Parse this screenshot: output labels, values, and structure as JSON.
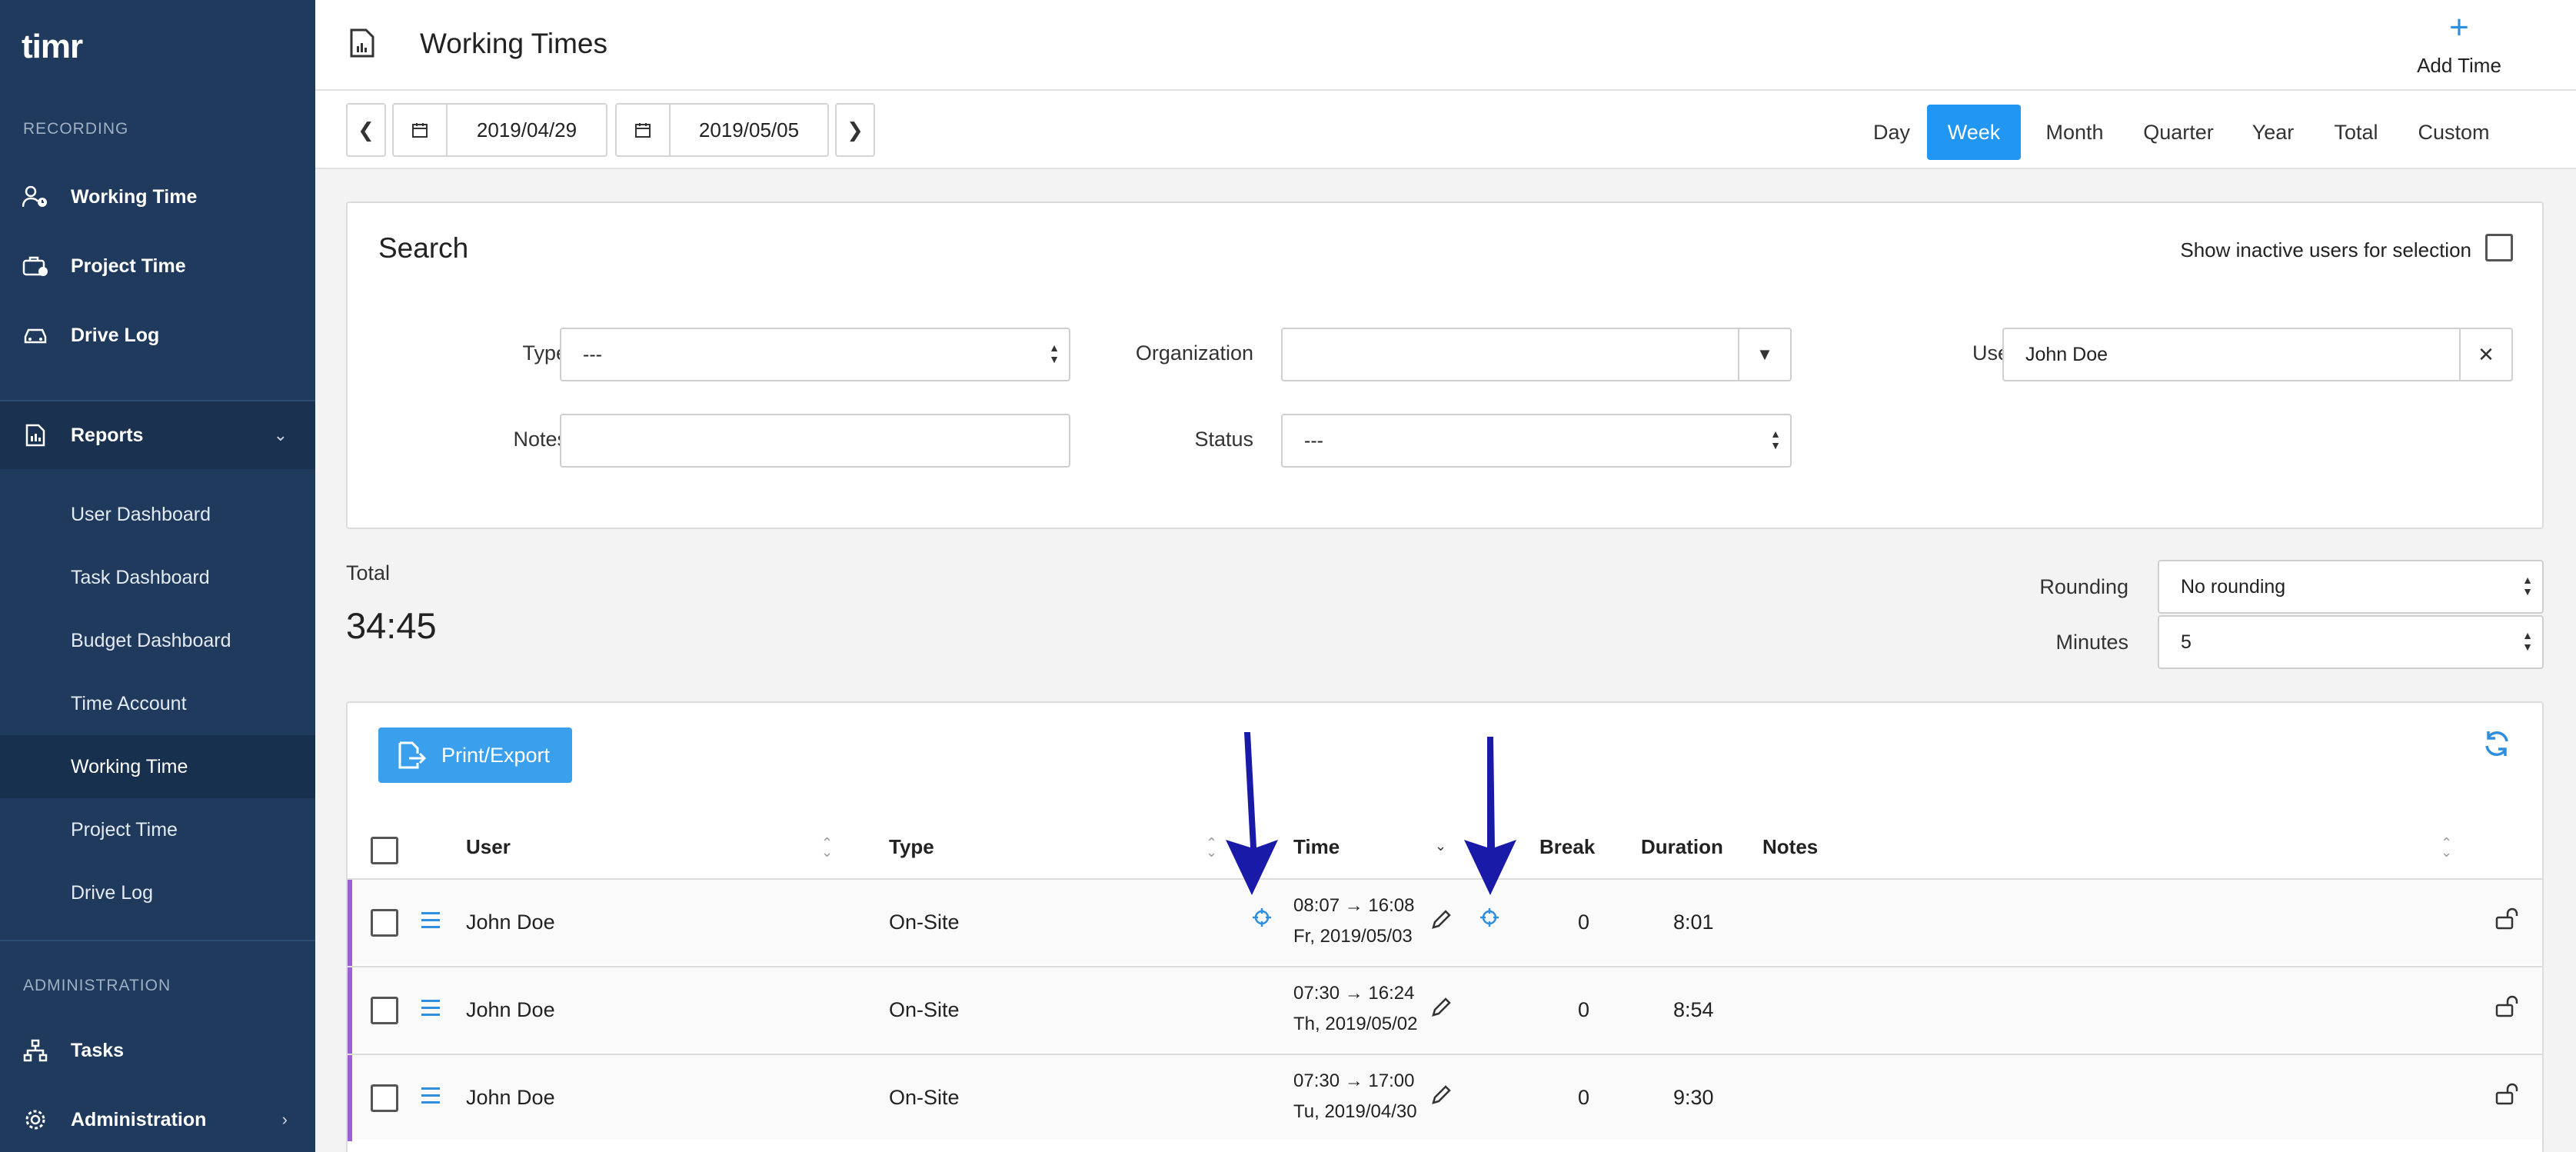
{
  "app": {
    "logo": "timr"
  },
  "sidebar": {
    "recording_label": "RECORDING",
    "recording_items": [
      {
        "label": "Working Time",
        "icon": "user-clock-icon"
      },
      {
        "label": "Project Time",
        "icon": "briefcase-icon"
      },
      {
        "label": "Drive Log",
        "icon": "car-icon"
      }
    ],
    "reports": {
      "label": "Reports",
      "icon": "report-icon"
    },
    "report_items": [
      "User Dashboard",
      "Task Dashboard",
      "Budget Dashboard",
      "Time Account",
      "Working Time",
      "Project Time",
      "Drive Log"
    ],
    "active_report_item": "Working Time",
    "administration_label": "ADMINISTRATION",
    "admin_items": [
      {
        "label": "Tasks",
        "icon": "sitemap-icon"
      },
      {
        "label": "Administration",
        "icon": "gear-icon"
      }
    ]
  },
  "header": {
    "title": "Working Times",
    "add_time_label": "Add Time"
  },
  "datebar": {
    "start_date": "2019/04/29",
    "end_date": "2019/05/05",
    "periods": [
      "Day",
      "Week",
      "Month",
      "Quarter",
      "Year",
      "Total",
      "Custom"
    ],
    "active_period": "Week"
  },
  "search": {
    "title": "Search",
    "show_inactive_label": "Show inactive users for selection",
    "type_label": "Type",
    "type_value": "---",
    "organization_label": "Organization",
    "organization_value": "",
    "user_label": "User",
    "user_value": "John Doe",
    "notes_label": "Notes",
    "notes_value": "",
    "status_label": "Status",
    "status_value": "---"
  },
  "summary": {
    "total_label": "Total",
    "total_value": "34:45",
    "rounding_label": "Rounding",
    "rounding_value": "No rounding",
    "minutes_label": "Minutes",
    "minutes_value": "5"
  },
  "table": {
    "print_export_label": "Print/Export",
    "columns": {
      "user": "User",
      "type": "Type",
      "time": "Time",
      "break": "Break",
      "duration": "Duration",
      "notes": "Notes"
    },
    "rows": [
      {
        "user": "John Doe",
        "type": "On-Site",
        "time_range": "08:07 → 16:08",
        "date": "Fr, 2019/05/03",
        "break": "0",
        "duration": "8:01",
        "notes": "",
        "has_location": true
      },
      {
        "user": "John Doe",
        "type": "On-Site",
        "time_range": "07:30 → 16:24",
        "date": "Th, 2019/05/02",
        "break": "0",
        "duration": "8:54",
        "notes": "",
        "has_location": false
      },
      {
        "user": "John Doe",
        "type": "On-Site",
        "time_range": "07:30 → 17:00",
        "date": "Tu, 2019/04/30",
        "break": "0",
        "duration": "9:30",
        "notes": "",
        "has_location": false
      }
    ]
  },
  "colors": {
    "sidebar_bg": "#1f3a5c",
    "accent_blue": "#2196f3",
    "row_accent": "#9c5fd6",
    "annotation_arrow": "#1a1aa8"
  }
}
